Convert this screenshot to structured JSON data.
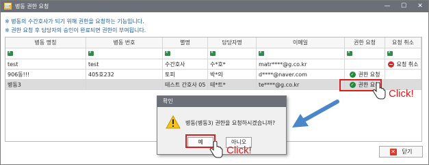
{
  "window": {
    "title": "병동 권한 요청",
    "minimize": "—",
    "maximize": "☐",
    "close": "✕"
  },
  "notices": [
    "※ 병동의 수간호사가 되기 위해 권한을 요청하는 기능입니다.",
    "※ 권한 요청 후 담당자의 승인이 완료되면 권한이 부여됩니다."
  ],
  "table": {
    "columns": [
      "병동 명칭",
      "병동 번호",
      "별명",
      "담당자명",
      "이메일",
      "권한 요청",
      "요청 취소"
    ],
    "rows": [
      {
        "ward_name": "test",
        "ward_no": "test",
        "nickname": "수간호사",
        "manager": "수*호*",
        "email": "matr****@g.co.kr",
        "request": "",
        "cancel": "요청 취소",
        "cancel_icon": "minus-circle-icon"
      },
      {
        "ward_name": "906동!!!",
        "ward_no": "405호232",
        "nickname": "토피",
        "manager": "박*의",
        "email": "d****@naver.com",
        "request": "권한 요청",
        "request_icon": "check-circle-icon",
        "cancel": ""
      },
      {
        "ward_name": "병동3",
        "ward_no": "",
        "nickname": "테스트 간호사 05",
        "manager": "테*트*",
        "email": "te****@g.co.kr",
        "request": "권한 요청",
        "request_icon": "check-circle-icon",
        "cancel": "",
        "selected": true
      }
    ]
  },
  "dialog": {
    "title": "확인",
    "message": "병동(병동3) 권한을 요청하시겠습니까?",
    "yes_label": "예",
    "no_label": "아니오",
    "icon": "warning-icon"
  },
  "footer": {
    "close_label": "닫기"
  },
  "annotations": {
    "click_label_1": "Click!",
    "click_label_2": "Click!",
    "highlight_color": "#d41f1f",
    "arrow_color": "#4a86c8"
  }
}
